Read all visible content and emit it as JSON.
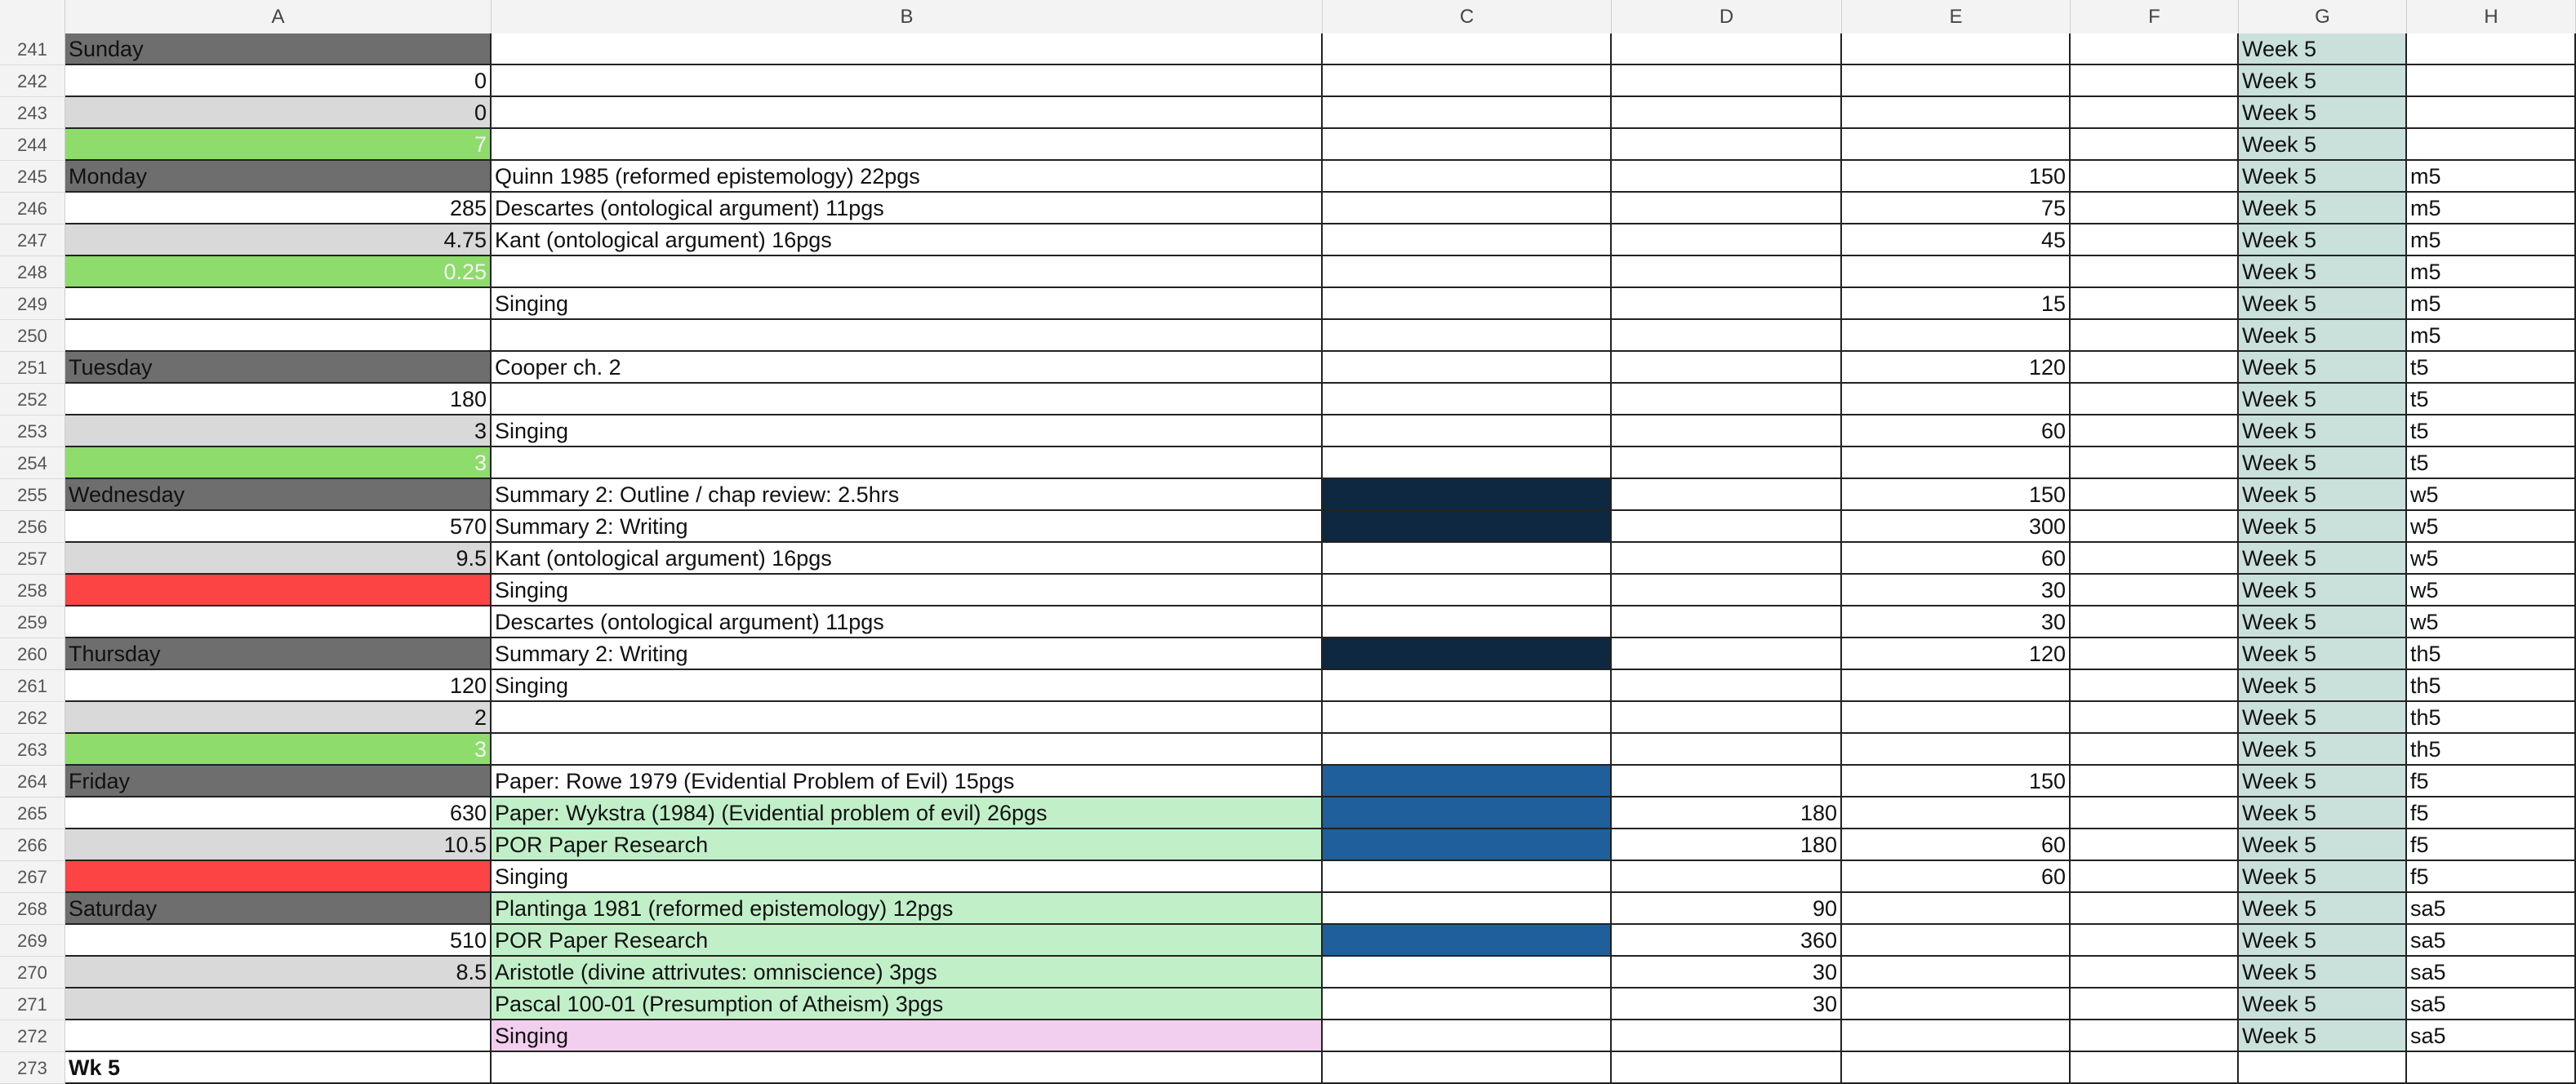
{
  "columns": [
    "A",
    "B",
    "C",
    "D",
    "E",
    "F",
    "G",
    "H"
  ],
  "colors": {
    "day_header": "#6e6e6e",
    "light_gray": "#d9d9d9",
    "green": "#8edc6b",
    "red": "#fb4443",
    "navy": "#0e2841",
    "blue": "#1f5f9b",
    "light_green": "#c1f0c8",
    "pink": "#f2cfee",
    "teal_light": "#c9e0db",
    "white": "#ffffff"
  },
  "rows": [
    {
      "n": "241",
      "A": "Sunday",
      "Ab": "day_header",
      "B": "",
      "C": "",
      "D": "",
      "E": "",
      "G": "Week 5",
      "H": ""
    },
    {
      "n": "242",
      "A": "0",
      "Ab": "white",
      "An": 1,
      "B": "",
      "C": "",
      "D": "",
      "E": "",
      "G": "Week 5",
      "H": ""
    },
    {
      "n": "243",
      "A": "0",
      "Ab": "light_gray",
      "An": 1,
      "B": "",
      "C": "",
      "D": "",
      "E": "",
      "G": "Week 5",
      "H": ""
    },
    {
      "n": "244",
      "A": "7",
      "Ab": "green",
      "An": 1,
      "Alight": 1,
      "B": "",
      "C": "",
      "D": "",
      "E": "",
      "G": "Week 5",
      "H": ""
    },
    {
      "n": "245",
      "A": "Monday",
      "Ab": "day_header",
      "B": "Quinn 1985 (reformed epistemology) 22pgs",
      "C": "",
      "D": "",
      "E": "150",
      "G": "Week 5",
      "H": "m5"
    },
    {
      "n": "246",
      "A": "285",
      "Ab": "white",
      "An": 1,
      "B": "Descartes (ontological argument) 11pgs",
      "C": "",
      "D": "",
      "E": "75",
      "G": "Week 5",
      "H": "m5"
    },
    {
      "n": "247",
      "A": "4.75",
      "Ab": "light_gray",
      "An": 1,
      "B": "Kant (ontological argument) 16pgs",
      "C": "",
      "D": "",
      "E": "45",
      "G": "Week 5",
      "H": "m5"
    },
    {
      "n": "248",
      "A": "0.25",
      "Ab": "green",
      "An": 1,
      "Alight": 1,
      "B": "",
      "C": "",
      "D": "",
      "E": "",
      "G": "Week 5",
      "H": "m5"
    },
    {
      "n": "249",
      "A": "",
      "Ab": "white",
      "B": "Singing",
      "C": "",
      "D": "",
      "E": "15",
      "G": "Week 5",
      "H": "m5"
    },
    {
      "n": "250",
      "A": "",
      "Ab": "white",
      "B": "",
      "C": "",
      "D": "",
      "E": "",
      "G": "Week 5",
      "H": "m5"
    },
    {
      "n": "251",
      "A": "Tuesday",
      "Ab": "day_header",
      "B": "Cooper ch. 2",
      "C": "",
      "D": "",
      "E": "120",
      "G": "Week 5",
      "H": "t5"
    },
    {
      "n": "252",
      "A": "180",
      "Ab": "white",
      "An": 1,
      "B": "",
      "C": "",
      "D": "",
      "E": "",
      "G": "Week 5",
      "H": "t5"
    },
    {
      "n": "253",
      "A": "3",
      "Ab": "light_gray",
      "An": 1,
      "B": "Singing",
      "C": "",
      "D": "",
      "E": "60",
      "G": "Week 5",
      "H": "t5"
    },
    {
      "n": "254",
      "A": "3",
      "Ab": "green",
      "An": 1,
      "Alight": 1,
      "B": "",
      "C": "",
      "D": "",
      "E": "",
      "G": "Week 5",
      "H": "t5"
    },
    {
      "n": "255",
      "A": "Wednesday",
      "Ab": "day_header",
      "B": "Summary 2: Outline / chap review: 2.5hrs",
      "Cb": "navy",
      "C": "",
      "D": "",
      "E": "150",
      "G": "Week 5",
      "H": "w5"
    },
    {
      "n": "256",
      "A": "570",
      "Ab": "white",
      "An": 1,
      "B": "Summary 2: Writing",
      "Cb": "navy",
      "C": "",
      "D": "",
      "E": "300",
      "G": "Week 5",
      "H": "w5"
    },
    {
      "n": "257",
      "A": "9.5",
      "Ab": "light_gray",
      "An": 1,
      "B": "Kant (ontological argument) 16pgs",
      "C": "",
      "D": "",
      "E": "60",
      "G": "Week 5",
      "H": "w5"
    },
    {
      "n": "258",
      "A": "",
      "Ab": "red",
      "B": "Singing",
      "C": "",
      "D": "",
      "E": "30",
      "G": "Week 5",
      "H": "w5"
    },
    {
      "n": "259",
      "A": "",
      "Ab": "white",
      "B": "Descartes (ontological argument) 11pgs",
      "C": "",
      "D": "",
      "E": "30",
      "G": "Week 5",
      "H": "w5"
    },
    {
      "n": "260",
      "A": "Thursday",
      "Ab": "day_header",
      "B": "Summary 2: Writing",
      "Cb": "navy",
      "C": "",
      "D": "",
      "E": "120",
      "G": "Week 5",
      "H": "th5"
    },
    {
      "n": "261",
      "A": "120",
      "Ab": "white",
      "An": 1,
      "B": "Singing",
      "C": "",
      "D": "",
      "E": "",
      "G": "Week 5",
      "H": "th5"
    },
    {
      "n": "262",
      "A": "2",
      "Ab": "light_gray",
      "An": 1,
      "B": "",
      "C": "",
      "D": "",
      "E": "",
      "G": "Week 5",
      "H": "th5"
    },
    {
      "n": "263",
      "A": "3",
      "Ab": "green",
      "An": 1,
      "Alight": 1,
      "B": "",
      "C": "",
      "D": "",
      "E": "",
      "G": "Week 5",
      "H": "th5"
    },
    {
      "n": "264",
      "A": "Friday",
      "Ab": "day_header",
      "B": "Paper: Rowe 1979 (Evidential Problem of Evil) 15pgs",
      "Cb": "blue",
      "C": "",
      "D": "",
      "E": "150",
      "G": "Week 5",
      "H": "f5"
    },
    {
      "n": "265",
      "A": "630",
      "Ab": "white",
      "An": 1,
      "B": "Paper: Wykstra (1984) (Evidential problem of evil) 26pgs",
      "Bb": "light_green",
      "Cb": "blue",
      "C": "",
      "D": "180",
      "E": "",
      "G": "Week 5",
      "H": "f5"
    },
    {
      "n": "266",
      "A": "10.5",
      "Ab": "light_gray",
      "An": 1,
      "B": "POR Paper Research",
      "Bb": "light_green",
      "Cb": "blue",
      "C": "",
      "D": "180",
      "E": "60",
      "G": "Week 5",
      "H": "f5"
    },
    {
      "n": "267",
      "A": "",
      "Ab": "red",
      "B": "Singing",
      "C": "",
      "D": "",
      "E": "60",
      "G": "Week 5",
      "H": "f5"
    },
    {
      "n": "268",
      "A": "Saturday",
      "Ab": "day_header",
      "B": "Plantinga 1981 (reformed epistemology) 12pgs",
      "Bb": "light_green",
      "C": "",
      "D": "90",
      "E": "",
      "G": "Week 5",
      "H": "sa5"
    },
    {
      "n": "269",
      "A": "510",
      "Ab": "white",
      "An": 1,
      "B": "POR Paper Research",
      "Bb": "light_green",
      "Cb": "blue",
      "C": "",
      "D": "360",
      "E": "",
      "G": "Week 5",
      "H": "sa5"
    },
    {
      "n": "270",
      "A": "8.5",
      "Ab": "light_gray",
      "An": 1,
      "B": "Aristotle (divine attrivutes: omniscience) 3pgs",
      "Bb": "light_green",
      "C": "",
      "D": "30",
      "E": "",
      "G": "Week 5",
      "H": "sa5"
    },
    {
      "n": "271",
      "A": "",
      "Ab": "light_gray",
      "B": "Pascal 100-01 (Presumption of Atheism) 3pgs",
      "Bb": "light_green",
      "C": "",
      "D": "30",
      "E": "",
      "G": "Week 5",
      "H": "sa5"
    },
    {
      "n": "272",
      "A": "",
      "Ab": "white",
      "B": "Singing",
      "Bb": "pink",
      "C": "",
      "D": "",
      "E": "",
      "G": "Week 5",
      "H": "sa5"
    },
    {
      "n": "273",
      "A": "Wk 5",
      "Ab": "white",
      "Abold": 1,
      "B": "",
      "C": "",
      "D": "",
      "E": "",
      "G": "",
      "H": ""
    }
  ]
}
